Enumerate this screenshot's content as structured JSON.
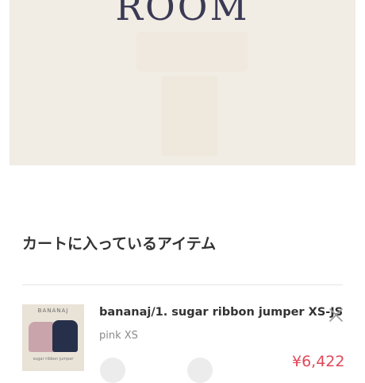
{
  "header": {
    "brand": "ROOM"
  },
  "cart": {
    "title": "カートに入っているアイテム",
    "items": [
      {
        "thumb_label": "BANANAJ",
        "thumb_caption": "sugar ribbon jumper",
        "name": "bananaj/1. sugar ribbon jumper XS-JS",
        "variant": "pink XS",
        "price": "¥6,422",
        "remove_icon": "close-icon"
      }
    ]
  },
  "colors": {
    "hero_bg": "#f1ece4",
    "brand": "#3b3a55",
    "price": "#e0485a"
  }
}
